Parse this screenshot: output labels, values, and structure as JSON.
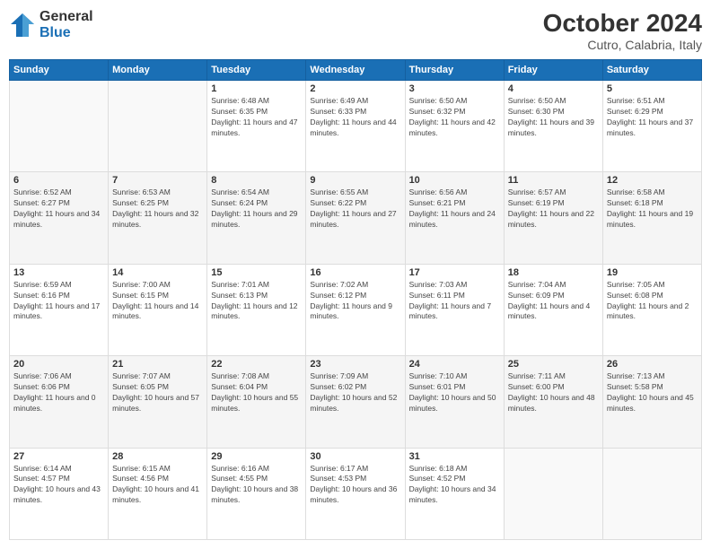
{
  "logo": {
    "general": "General",
    "blue": "Blue"
  },
  "title": "October 2024",
  "subtitle": "Cutro, Calabria, Italy",
  "weekdays": [
    "Sunday",
    "Monday",
    "Tuesday",
    "Wednesday",
    "Thursday",
    "Friday",
    "Saturday"
  ],
  "weeks": [
    [
      {
        "day": "",
        "info": ""
      },
      {
        "day": "",
        "info": ""
      },
      {
        "day": "1",
        "info": "Sunrise: 6:48 AM\nSunset: 6:35 PM\nDaylight: 11 hours and 47 minutes."
      },
      {
        "day": "2",
        "info": "Sunrise: 6:49 AM\nSunset: 6:33 PM\nDaylight: 11 hours and 44 minutes."
      },
      {
        "day": "3",
        "info": "Sunrise: 6:50 AM\nSunset: 6:32 PM\nDaylight: 11 hours and 42 minutes."
      },
      {
        "day": "4",
        "info": "Sunrise: 6:50 AM\nSunset: 6:30 PM\nDaylight: 11 hours and 39 minutes."
      },
      {
        "day": "5",
        "info": "Sunrise: 6:51 AM\nSunset: 6:29 PM\nDaylight: 11 hours and 37 minutes."
      }
    ],
    [
      {
        "day": "6",
        "info": "Sunrise: 6:52 AM\nSunset: 6:27 PM\nDaylight: 11 hours and 34 minutes."
      },
      {
        "day": "7",
        "info": "Sunrise: 6:53 AM\nSunset: 6:25 PM\nDaylight: 11 hours and 32 minutes."
      },
      {
        "day": "8",
        "info": "Sunrise: 6:54 AM\nSunset: 6:24 PM\nDaylight: 11 hours and 29 minutes."
      },
      {
        "day": "9",
        "info": "Sunrise: 6:55 AM\nSunset: 6:22 PM\nDaylight: 11 hours and 27 minutes."
      },
      {
        "day": "10",
        "info": "Sunrise: 6:56 AM\nSunset: 6:21 PM\nDaylight: 11 hours and 24 minutes."
      },
      {
        "day": "11",
        "info": "Sunrise: 6:57 AM\nSunset: 6:19 PM\nDaylight: 11 hours and 22 minutes."
      },
      {
        "day": "12",
        "info": "Sunrise: 6:58 AM\nSunset: 6:18 PM\nDaylight: 11 hours and 19 minutes."
      }
    ],
    [
      {
        "day": "13",
        "info": "Sunrise: 6:59 AM\nSunset: 6:16 PM\nDaylight: 11 hours and 17 minutes."
      },
      {
        "day": "14",
        "info": "Sunrise: 7:00 AM\nSunset: 6:15 PM\nDaylight: 11 hours and 14 minutes."
      },
      {
        "day": "15",
        "info": "Sunrise: 7:01 AM\nSunset: 6:13 PM\nDaylight: 11 hours and 12 minutes."
      },
      {
        "day": "16",
        "info": "Sunrise: 7:02 AM\nSunset: 6:12 PM\nDaylight: 11 hours and 9 minutes."
      },
      {
        "day": "17",
        "info": "Sunrise: 7:03 AM\nSunset: 6:11 PM\nDaylight: 11 hours and 7 minutes."
      },
      {
        "day": "18",
        "info": "Sunrise: 7:04 AM\nSunset: 6:09 PM\nDaylight: 11 hours and 4 minutes."
      },
      {
        "day": "19",
        "info": "Sunrise: 7:05 AM\nSunset: 6:08 PM\nDaylight: 11 hours and 2 minutes."
      }
    ],
    [
      {
        "day": "20",
        "info": "Sunrise: 7:06 AM\nSunset: 6:06 PM\nDaylight: 11 hours and 0 minutes."
      },
      {
        "day": "21",
        "info": "Sunrise: 7:07 AM\nSunset: 6:05 PM\nDaylight: 10 hours and 57 minutes."
      },
      {
        "day": "22",
        "info": "Sunrise: 7:08 AM\nSunset: 6:04 PM\nDaylight: 10 hours and 55 minutes."
      },
      {
        "day": "23",
        "info": "Sunrise: 7:09 AM\nSunset: 6:02 PM\nDaylight: 10 hours and 52 minutes."
      },
      {
        "day": "24",
        "info": "Sunrise: 7:10 AM\nSunset: 6:01 PM\nDaylight: 10 hours and 50 minutes."
      },
      {
        "day": "25",
        "info": "Sunrise: 7:11 AM\nSunset: 6:00 PM\nDaylight: 10 hours and 48 minutes."
      },
      {
        "day": "26",
        "info": "Sunrise: 7:13 AM\nSunset: 5:58 PM\nDaylight: 10 hours and 45 minutes."
      }
    ],
    [
      {
        "day": "27",
        "info": "Sunrise: 6:14 AM\nSunset: 4:57 PM\nDaylight: 10 hours and 43 minutes."
      },
      {
        "day": "28",
        "info": "Sunrise: 6:15 AM\nSunset: 4:56 PM\nDaylight: 10 hours and 41 minutes."
      },
      {
        "day": "29",
        "info": "Sunrise: 6:16 AM\nSunset: 4:55 PM\nDaylight: 10 hours and 38 minutes."
      },
      {
        "day": "30",
        "info": "Sunrise: 6:17 AM\nSunset: 4:53 PM\nDaylight: 10 hours and 36 minutes."
      },
      {
        "day": "31",
        "info": "Sunrise: 6:18 AM\nSunset: 4:52 PM\nDaylight: 10 hours and 34 minutes."
      },
      {
        "day": "",
        "info": ""
      },
      {
        "day": "",
        "info": ""
      }
    ]
  ]
}
